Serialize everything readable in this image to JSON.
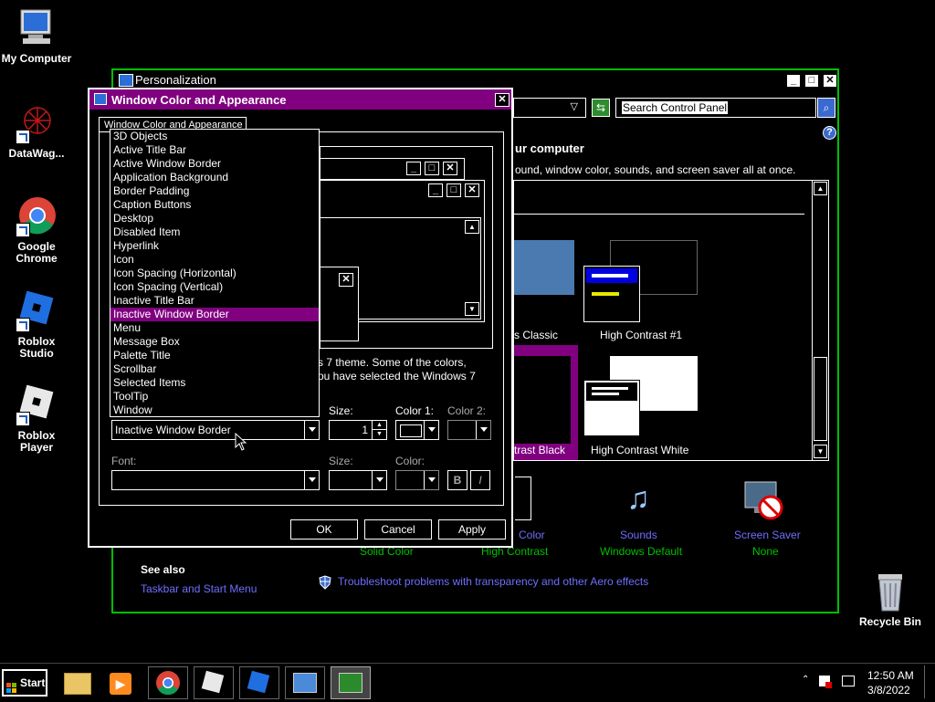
{
  "desktop": {
    "icons": [
      {
        "label": "My Computer"
      },
      {
        "label": "DataWag..."
      },
      {
        "label": "Google Chrome"
      },
      {
        "label": "Roblox Studio"
      },
      {
        "label": "Roblox Player"
      },
      {
        "label": "Recycle Bin"
      }
    ]
  },
  "personalization": {
    "title": "Personalization",
    "search_placeholder": "Search Control Panel",
    "heading_partial": "ur computer",
    "desc_partial": "ound, window color, sounds, and screen saver all at once.",
    "themes": [
      {
        "label": "s Classic"
      },
      {
        "label": "High Contrast #1"
      },
      {
        "label": "trast Black"
      },
      {
        "label": "High Contrast White"
      }
    ],
    "bottom": [
      {
        "title": "Color",
        "sub": "Solid Color"
      },
      {
        "title": "",
        "sub": "High Contrast"
      },
      {
        "title": "Sounds",
        "sub": "Windows Default"
      },
      {
        "title": "Screen Saver",
        "sub": "None"
      }
    ],
    "see_also": "See also",
    "taskbar_link": "Taskbar and Start Menu",
    "troubleshoot": "Troubleshoot problems with transparency and other Aero effects"
  },
  "dialog": {
    "title": "Window Color and Appearance",
    "tab": "Window Color and Appearance",
    "theme_text_1": "s 7 theme.  Some of the colors,",
    "theme_text_2": "ou have selected the Windows 7",
    "item_options": [
      "3D Objects",
      "Active Title Bar",
      "Active Window Border",
      "Application Background",
      "Border Padding",
      "Caption Buttons",
      "Desktop",
      "Disabled Item",
      "Hyperlink",
      "Icon",
      "Icon Spacing (Horizontal)",
      "Icon Spacing (Vertical)",
      "Inactive Title Bar",
      "Inactive Window Border",
      "Menu",
      "Message Box",
      "Palette Title",
      "Scrollbar",
      "Selected Items",
      "ToolTip",
      "Window"
    ],
    "selected_item": "Inactive Window Border",
    "size_label": "Size:",
    "size_value": "1",
    "color1_label": "Color 1:",
    "color2_label": "Color 2:",
    "font_label": "Font:",
    "font_size_label": "Size:",
    "font_color_label": "Color:",
    "bold_label": "B",
    "italic_label": "I",
    "ok": "OK",
    "cancel": "Cancel",
    "apply": "Apply"
  },
  "taskbar": {
    "start": "Start",
    "time": "12:50 AM",
    "date": "3/8/2022"
  },
  "colors": {
    "accent": "#800080",
    "frame": "#00c000",
    "link": "#6e6eff"
  }
}
